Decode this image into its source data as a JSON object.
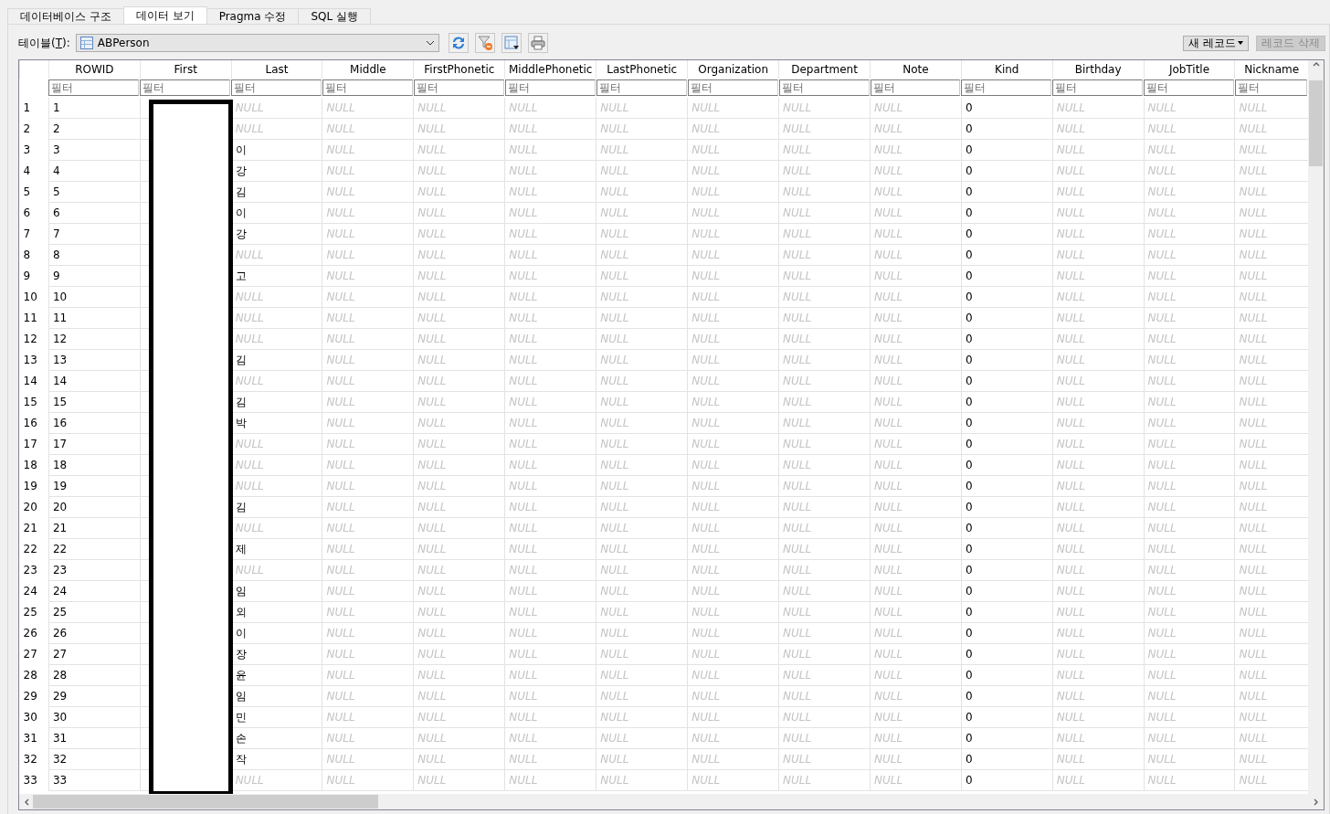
{
  "tabs": [
    {
      "label": "데이터베이스 구조",
      "selected": false
    },
    {
      "label": "데이터 보기",
      "selected": true
    },
    {
      "label": "Pragma 수정",
      "selected": false
    },
    {
      "label": "SQL 실행",
      "selected": false
    }
  ],
  "toolbar": {
    "label_before": "테이블(",
    "accel": "T",
    "label_after": "):",
    "table": "ABPerson",
    "new_record": "새 레코드",
    "delete_record": {
      "label": "레코드 삭제",
      "disabled": true
    }
  },
  "grid": {
    "columns": [
      "ROWID",
      "First",
      "Last",
      "Middle",
      "FirstPhonetic",
      "MiddlePhonetic",
      "LastPhonetic",
      "Organization",
      "Department",
      "Note",
      "Kind",
      "Birthday",
      "JobTitle",
      "Nickname"
    ],
    "filter_placeholders": [
      "필터",
      "필터",
      "필터",
      "필터",
      "필터",
      "필터",
      "필터",
      "필터",
      "필터",
      "필터",
      "필터",
      "필터",
      "필터",
      "필터"
    ],
    "first_column_redacted": true,
    "rows": [
      {
        "num": "1",
        "cells": [
          {
            "t": "1",
            "null": false
          },
          null,
          {
            "t": "NULL",
            "null": true
          },
          {
            "t": "NULL",
            "null": true
          },
          {
            "t": "NULL",
            "null": true
          },
          {
            "t": "NULL",
            "null": true
          },
          {
            "t": "NULL",
            "null": true
          },
          {
            "t": "NULL",
            "null": true
          },
          {
            "t": "NULL",
            "null": true
          },
          {
            "t": "NULL",
            "null": true
          },
          {
            "t": "0",
            "null": false
          },
          {
            "t": "NULL",
            "null": true
          },
          {
            "t": "NULL",
            "null": true
          },
          {
            "t": "NULL",
            "null": true
          }
        ]
      },
      {
        "num": "2",
        "cells": [
          {
            "t": "2",
            "null": false
          },
          null,
          {
            "t": "NULL",
            "null": true
          },
          {
            "t": "NULL",
            "null": true
          },
          {
            "t": "NULL",
            "null": true
          },
          {
            "t": "NULL",
            "null": true
          },
          {
            "t": "NULL",
            "null": true
          },
          {
            "t": "NULL",
            "null": true
          },
          {
            "t": "NULL",
            "null": true
          },
          {
            "t": "NULL",
            "null": true
          },
          {
            "t": "0",
            "null": false
          },
          {
            "t": "NULL",
            "null": true
          },
          {
            "t": "NULL",
            "null": true
          },
          {
            "t": "NULL",
            "null": true
          }
        ]
      },
      {
        "num": "3",
        "cells": [
          {
            "t": "3",
            "null": false
          },
          null,
          {
            "t": "이",
            "null": false
          },
          {
            "t": "NULL",
            "null": true
          },
          {
            "t": "NULL",
            "null": true
          },
          {
            "t": "NULL",
            "null": true
          },
          {
            "t": "NULL",
            "null": true
          },
          {
            "t": "NULL",
            "null": true
          },
          {
            "t": "NULL",
            "null": true
          },
          {
            "t": "NULL",
            "null": true
          },
          {
            "t": "0",
            "null": false
          },
          {
            "t": "NULL",
            "null": true
          },
          {
            "t": "NULL",
            "null": true
          },
          {
            "t": "NULL",
            "null": true
          }
        ]
      },
      {
        "num": "4",
        "cells": [
          {
            "t": "4",
            "null": false
          },
          null,
          {
            "t": "강",
            "null": false
          },
          {
            "t": "NULL",
            "null": true
          },
          {
            "t": "NULL",
            "null": true
          },
          {
            "t": "NULL",
            "null": true
          },
          {
            "t": "NULL",
            "null": true
          },
          {
            "t": "NULL",
            "null": true
          },
          {
            "t": "NULL",
            "null": true
          },
          {
            "t": "NULL",
            "null": true
          },
          {
            "t": "0",
            "null": false
          },
          {
            "t": "NULL",
            "null": true
          },
          {
            "t": "NULL",
            "null": true
          },
          {
            "t": "NULL",
            "null": true
          }
        ]
      },
      {
        "num": "5",
        "cells": [
          {
            "t": "5",
            "null": false
          },
          null,
          {
            "t": "김",
            "null": false
          },
          {
            "t": "NULL",
            "null": true
          },
          {
            "t": "NULL",
            "null": true
          },
          {
            "t": "NULL",
            "null": true
          },
          {
            "t": "NULL",
            "null": true
          },
          {
            "t": "NULL",
            "null": true
          },
          {
            "t": "NULL",
            "null": true
          },
          {
            "t": "NULL",
            "null": true
          },
          {
            "t": "0",
            "null": false
          },
          {
            "t": "NULL",
            "null": true
          },
          {
            "t": "NULL",
            "null": true
          },
          {
            "t": "NULL",
            "null": true
          }
        ]
      },
      {
        "num": "6",
        "cells": [
          {
            "t": "6",
            "null": false
          },
          null,
          {
            "t": "이",
            "null": false
          },
          {
            "t": "NULL",
            "null": true
          },
          {
            "t": "NULL",
            "null": true
          },
          {
            "t": "NULL",
            "null": true
          },
          {
            "t": "NULL",
            "null": true
          },
          {
            "t": "NULL",
            "null": true
          },
          {
            "t": "NULL",
            "null": true
          },
          {
            "t": "NULL",
            "null": true
          },
          {
            "t": "0",
            "null": false
          },
          {
            "t": "NULL",
            "null": true
          },
          {
            "t": "NULL",
            "null": true
          },
          {
            "t": "NULL",
            "null": true
          }
        ]
      },
      {
        "num": "7",
        "cells": [
          {
            "t": "7",
            "null": false
          },
          null,
          {
            "t": "강",
            "null": false
          },
          {
            "t": "NULL",
            "null": true
          },
          {
            "t": "NULL",
            "null": true
          },
          {
            "t": "NULL",
            "null": true
          },
          {
            "t": "NULL",
            "null": true
          },
          {
            "t": "NULL",
            "null": true
          },
          {
            "t": "NULL",
            "null": true
          },
          {
            "t": "NULL",
            "null": true
          },
          {
            "t": "0",
            "null": false
          },
          {
            "t": "NULL",
            "null": true
          },
          {
            "t": "NULL",
            "null": true
          },
          {
            "t": "NULL",
            "null": true
          }
        ]
      },
      {
        "num": "8",
        "cells": [
          {
            "t": "8",
            "null": false
          },
          null,
          {
            "t": "NULL",
            "null": true
          },
          {
            "t": "NULL",
            "null": true
          },
          {
            "t": "NULL",
            "null": true
          },
          {
            "t": "NULL",
            "null": true
          },
          {
            "t": "NULL",
            "null": true
          },
          {
            "t": "NULL",
            "null": true
          },
          {
            "t": "NULL",
            "null": true
          },
          {
            "t": "NULL",
            "null": true
          },
          {
            "t": "0",
            "null": false
          },
          {
            "t": "NULL",
            "null": true
          },
          {
            "t": "NULL",
            "null": true
          },
          {
            "t": "NULL",
            "null": true
          }
        ]
      },
      {
        "num": "9",
        "cells": [
          {
            "t": "9",
            "null": false
          },
          null,
          {
            "t": "고",
            "null": false
          },
          {
            "t": "NULL",
            "null": true
          },
          {
            "t": "NULL",
            "null": true
          },
          {
            "t": "NULL",
            "null": true
          },
          {
            "t": "NULL",
            "null": true
          },
          {
            "t": "NULL",
            "null": true
          },
          {
            "t": "NULL",
            "null": true
          },
          {
            "t": "NULL",
            "null": true
          },
          {
            "t": "0",
            "null": false
          },
          {
            "t": "NULL",
            "null": true
          },
          {
            "t": "NULL",
            "null": true
          },
          {
            "t": "NULL",
            "null": true
          }
        ]
      },
      {
        "num": "10",
        "cells": [
          {
            "t": "10",
            "null": false
          },
          null,
          {
            "t": "NULL",
            "null": true
          },
          {
            "t": "NULL",
            "null": true
          },
          {
            "t": "NULL",
            "null": true
          },
          {
            "t": "NULL",
            "null": true
          },
          {
            "t": "NULL",
            "null": true
          },
          {
            "t": "NULL",
            "null": true
          },
          {
            "t": "NULL",
            "null": true
          },
          {
            "t": "NULL",
            "null": true
          },
          {
            "t": "0",
            "null": false
          },
          {
            "t": "NULL",
            "null": true
          },
          {
            "t": "NULL",
            "null": true
          },
          {
            "t": "NULL",
            "null": true
          }
        ]
      },
      {
        "num": "11",
        "cells": [
          {
            "t": "11",
            "null": false
          },
          null,
          {
            "t": "NULL",
            "null": true
          },
          {
            "t": "NULL",
            "null": true
          },
          {
            "t": "NULL",
            "null": true
          },
          {
            "t": "NULL",
            "null": true
          },
          {
            "t": "NULL",
            "null": true
          },
          {
            "t": "NULL",
            "null": true
          },
          {
            "t": "NULL",
            "null": true
          },
          {
            "t": "NULL",
            "null": true
          },
          {
            "t": "0",
            "null": false
          },
          {
            "t": "NULL",
            "null": true
          },
          {
            "t": "NULL",
            "null": true
          },
          {
            "t": "NULL",
            "null": true
          }
        ]
      },
      {
        "num": "12",
        "cells": [
          {
            "t": "12",
            "null": false
          },
          null,
          {
            "t": "NULL",
            "null": true
          },
          {
            "t": "NULL",
            "null": true
          },
          {
            "t": "NULL",
            "null": true
          },
          {
            "t": "NULL",
            "null": true
          },
          {
            "t": "NULL",
            "null": true
          },
          {
            "t": "NULL",
            "null": true
          },
          {
            "t": "NULL",
            "null": true
          },
          {
            "t": "NULL",
            "null": true
          },
          {
            "t": "0",
            "null": false
          },
          {
            "t": "NULL",
            "null": true
          },
          {
            "t": "NULL",
            "null": true
          },
          {
            "t": "NULL",
            "null": true
          }
        ]
      },
      {
        "num": "13",
        "cells": [
          {
            "t": "13",
            "null": false
          },
          null,
          {
            "t": "김",
            "null": false
          },
          {
            "t": "NULL",
            "null": true
          },
          {
            "t": "NULL",
            "null": true
          },
          {
            "t": "NULL",
            "null": true
          },
          {
            "t": "NULL",
            "null": true
          },
          {
            "t": "NULL",
            "null": true
          },
          {
            "t": "NULL",
            "null": true
          },
          {
            "t": "NULL",
            "null": true
          },
          {
            "t": "0",
            "null": false
          },
          {
            "t": "NULL",
            "null": true
          },
          {
            "t": "NULL",
            "null": true
          },
          {
            "t": "NULL",
            "null": true
          }
        ]
      },
      {
        "num": "14",
        "cells": [
          {
            "t": "14",
            "null": false
          },
          null,
          {
            "t": "NULL",
            "null": true
          },
          {
            "t": "NULL",
            "null": true
          },
          {
            "t": "NULL",
            "null": true
          },
          {
            "t": "NULL",
            "null": true
          },
          {
            "t": "NULL",
            "null": true
          },
          {
            "t": "NULL",
            "null": true
          },
          {
            "t": "NULL",
            "null": true
          },
          {
            "t": "NULL",
            "null": true
          },
          {
            "t": "0",
            "null": false
          },
          {
            "t": "NULL",
            "null": true
          },
          {
            "t": "NULL",
            "null": true
          },
          {
            "t": "NULL",
            "null": true
          }
        ]
      },
      {
        "num": "15",
        "cells": [
          {
            "t": "15",
            "null": false
          },
          null,
          {
            "t": "김",
            "null": false
          },
          {
            "t": "NULL",
            "null": true
          },
          {
            "t": "NULL",
            "null": true
          },
          {
            "t": "NULL",
            "null": true
          },
          {
            "t": "NULL",
            "null": true
          },
          {
            "t": "NULL",
            "null": true
          },
          {
            "t": "NULL",
            "null": true
          },
          {
            "t": "NULL",
            "null": true
          },
          {
            "t": "0",
            "null": false
          },
          {
            "t": "NULL",
            "null": true
          },
          {
            "t": "NULL",
            "null": true
          },
          {
            "t": "NULL",
            "null": true
          }
        ]
      },
      {
        "num": "16",
        "cells": [
          {
            "t": "16",
            "null": false
          },
          null,
          {
            "t": "박",
            "null": false
          },
          {
            "t": "NULL",
            "null": true
          },
          {
            "t": "NULL",
            "null": true
          },
          {
            "t": "NULL",
            "null": true
          },
          {
            "t": "NULL",
            "null": true
          },
          {
            "t": "NULL",
            "null": true
          },
          {
            "t": "NULL",
            "null": true
          },
          {
            "t": "NULL",
            "null": true
          },
          {
            "t": "0",
            "null": false
          },
          {
            "t": "NULL",
            "null": true
          },
          {
            "t": "NULL",
            "null": true
          },
          {
            "t": "NULL",
            "null": true
          }
        ]
      },
      {
        "num": "17",
        "cells": [
          {
            "t": "17",
            "null": false
          },
          null,
          {
            "t": "NULL",
            "null": true
          },
          {
            "t": "NULL",
            "null": true
          },
          {
            "t": "NULL",
            "null": true
          },
          {
            "t": "NULL",
            "null": true
          },
          {
            "t": "NULL",
            "null": true
          },
          {
            "t": "NULL",
            "null": true
          },
          {
            "t": "NULL",
            "null": true
          },
          {
            "t": "NULL",
            "null": true
          },
          {
            "t": "0",
            "null": false
          },
          {
            "t": "NULL",
            "null": true
          },
          {
            "t": "NULL",
            "null": true
          },
          {
            "t": "NULL",
            "null": true
          }
        ]
      },
      {
        "num": "18",
        "cells": [
          {
            "t": "18",
            "null": false
          },
          null,
          {
            "t": "NULL",
            "null": true
          },
          {
            "t": "NULL",
            "null": true
          },
          {
            "t": "NULL",
            "null": true
          },
          {
            "t": "NULL",
            "null": true
          },
          {
            "t": "NULL",
            "null": true
          },
          {
            "t": "NULL",
            "null": true
          },
          {
            "t": "NULL",
            "null": true
          },
          {
            "t": "NULL",
            "null": true
          },
          {
            "t": "0",
            "null": false
          },
          {
            "t": "NULL",
            "null": true
          },
          {
            "t": "NULL",
            "null": true
          },
          {
            "t": "NULL",
            "null": true
          }
        ]
      },
      {
        "num": "19",
        "cells": [
          {
            "t": "19",
            "null": false
          },
          null,
          {
            "t": "NULL",
            "null": true
          },
          {
            "t": "NULL",
            "null": true
          },
          {
            "t": "NULL",
            "null": true
          },
          {
            "t": "NULL",
            "null": true
          },
          {
            "t": "NULL",
            "null": true
          },
          {
            "t": "NULL",
            "null": true
          },
          {
            "t": "NULL",
            "null": true
          },
          {
            "t": "NULL",
            "null": true
          },
          {
            "t": "0",
            "null": false
          },
          {
            "t": "NULL",
            "null": true
          },
          {
            "t": "NULL",
            "null": true
          },
          {
            "t": "NULL",
            "null": true
          }
        ]
      },
      {
        "num": "20",
        "cells": [
          {
            "t": "20",
            "null": false
          },
          null,
          {
            "t": "김",
            "null": false
          },
          {
            "t": "NULL",
            "null": true
          },
          {
            "t": "NULL",
            "null": true
          },
          {
            "t": "NULL",
            "null": true
          },
          {
            "t": "NULL",
            "null": true
          },
          {
            "t": "NULL",
            "null": true
          },
          {
            "t": "NULL",
            "null": true
          },
          {
            "t": "NULL",
            "null": true
          },
          {
            "t": "0",
            "null": false
          },
          {
            "t": "NULL",
            "null": true
          },
          {
            "t": "NULL",
            "null": true
          },
          {
            "t": "NULL",
            "null": true
          }
        ]
      },
      {
        "num": "21",
        "cells": [
          {
            "t": "21",
            "null": false
          },
          null,
          {
            "t": "NULL",
            "null": true
          },
          {
            "t": "NULL",
            "null": true
          },
          {
            "t": "NULL",
            "null": true
          },
          {
            "t": "NULL",
            "null": true
          },
          {
            "t": "NULL",
            "null": true
          },
          {
            "t": "NULL",
            "null": true
          },
          {
            "t": "NULL",
            "null": true
          },
          {
            "t": "NULL",
            "null": true
          },
          {
            "t": "0",
            "null": false
          },
          {
            "t": "NULL",
            "null": true
          },
          {
            "t": "NULL",
            "null": true
          },
          {
            "t": "NULL",
            "null": true
          }
        ]
      },
      {
        "num": "22",
        "cells": [
          {
            "t": "22",
            "null": false
          },
          null,
          {
            "t": "제",
            "null": false
          },
          {
            "t": "NULL",
            "null": true
          },
          {
            "t": "NULL",
            "null": true
          },
          {
            "t": "NULL",
            "null": true
          },
          {
            "t": "NULL",
            "null": true
          },
          {
            "t": "NULL",
            "null": true
          },
          {
            "t": "NULL",
            "null": true
          },
          {
            "t": "NULL",
            "null": true
          },
          {
            "t": "0",
            "null": false
          },
          {
            "t": "NULL",
            "null": true
          },
          {
            "t": "NULL",
            "null": true
          },
          {
            "t": "NULL",
            "null": true
          }
        ]
      },
      {
        "num": "23",
        "cells": [
          {
            "t": "23",
            "null": false
          },
          null,
          {
            "t": "NULL",
            "null": true
          },
          {
            "t": "NULL",
            "null": true
          },
          {
            "t": "NULL",
            "null": true
          },
          {
            "t": "NULL",
            "null": true
          },
          {
            "t": "NULL",
            "null": true
          },
          {
            "t": "NULL",
            "null": true
          },
          {
            "t": "NULL",
            "null": true
          },
          {
            "t": "NULL",
            "null": true
          },
          {
            "t": "0",
            "null": false
          },
          {
            "t": "NULL",
            "null": true
          },
          {
            "t": "NULL",
            "null": true
          },
          {
            "t": "NULL",
            "null": true
          }
        ]
      },
      {
        "num": "24",
        "cells": [
          {
            "t": "24",
            "null": false
          },
          null,
          {
            "t": "임",
            "null": false
          },
          {
            "t": "NULL",
            "null": true
          },
          {
            "t": "NULL",
            "null": true
          },
          {
            "t": "NULL",
            "null": true
          },
          {
            "t": "NULL",
            "null": true
          },
          {
            "t": "NULL",
            "null": true
          },
          {
            "t": "NULL",
            "null": true
          },
          {
            "t": "NULL",
            "null": true
          },
          {
            "t": "0",
            "null": false
          },
          {
            "t": "NULL",
            "null": true
          },
          {
            "t": "NULL",
            "null": true
          },
          {
            "t": "NULL",
            "null": true
          }
        ]
      },
      {
        "num": "25",
        "cells": [
          {
            "t": "25",
            "null": false
          },
          null,
          {
            "t": "외",
            "null": false
          },
          {
            "t": "NULL",
            "null": true
          },
          {
            "t": "NULL",
            "null": true
          },
          {
            "t": "NULL",
            "null": true
          },
          {
            "t": "NULL",
            "null": true
          },
          {
            "t": "NULL",
            "null": true
          },
          {
            "t": "NULL",
            "null": true
          },
          {
            "t": "NULL",
            "null": true
          },
          {
            "t": "0",
            "null": false
          },
          {
            "t": "NULL",
            "null": true
          },
          {
            "t": "NULL",
            "null": true
          },
          {
            "t": "NULL",
            "null": true
          }
        ]
      },
      {
        "num": "26",
        "cells": [
          {
            "t": "26",
            "null": false
          },
          null,
          {
            "t": "이",
            "null": false
          },
          {
            "t": "NULL",
            "null": true
          },
          {
            "t": "NULL",
            "null": true
          },
          {
            "t": "NULL",
            "null": true
          },
          {
            "t": "NULL",
            "null": true
          },
          {
            "t": "NULL",
            "null": true
          },
          {
            "t": "NULL",
            "null": true
          },
          {
            "t": "NULL",
            "null": true
          },
          {
            "t": "0",
            "null": false
          },
          {
            "t": "NULL",
            "null": true
          },
          {
            "t": "NULL",
            "null": true
          },
          {
            "t": "NULL",
            "null": true
          }
        ]
      },
      {
        "num": "27",
        "cells": [
          {
            "t": "27",
            "null": false
          },
          null,
          {
            "t": "장",
            "null": false
          },
          {
            "t": "NULL",
            "null": true
          },
          {
            "t": "NULL",
            "null": true
          },
          {
            "t": "NULL",
            "null": true
          },
          {
            "t": "NULL",
            "null": true
          },
          {
            "t": "NULL",
            "null": true
          },
          {
            "t": "NULL",
            "null": true
          },
          {
            "t": "NULL",
            "null": true
          },
          {
            "t": "0",
            "null": false
          },
          {
            "t": "NULL",
            "null": true
          },
          {
            "t": "NULL",
            "null": true
          },
          {
            "t": "NULL",
            "null": true
          }
        ]
      },
      {
        "num": "28",
        "cells": [
          {
            "t": "28",
            "null": false
          },
          null,
          {
            "t": "윤",
            "null": false
          },
          {
            "t": "NULL",
            "null": true
          },
          {
            "t": "NULL",
            "null": true
          },
          {
            "t": "NULL",
            "null": true
          },
          {
            "t": "NULL",
            "null": true
          },
          {
            "t": "NULL",
            "null": true
          },
          {
            "t": "NULL",
            "null": true
          },
          {
            "t": "NULL",
            "null": true
          },
          {
            "t": "0",
            "null": false
          },
          {
            "t": "NULL",
            "null": true
          },
          {
            "t": "NULL",
            "null": true
          },
          {
            "t": "NULL",
            "null": true
          }
        ]
      },
      {
        "num": "29",
        "cells": [
          {
            "t": "29",
            "null": false
          },
          null,
          {
            "t": "임",
            "null": false
          },
          {
            "t": "NULL",
            "null": true
          },
          {
            "t": "NULL",
            "null": true
          },
          {
            "t": "NULL",
            "null": true
          },
          {
            "t": "NULL",
            "null": true
          },
          {
            "t": "NULL",
            "null": true
          },
          {
            "t": "NULL",
            "null": true
          },
          {
            "t": "NULL",
            "null": true
          },
          {
            "t": "0",
            "null": false
          },
          {
            "t": "NULL",
            "null": true
          },
          {
            "t": "NULL",
            "null": true
          },
          {
            "t": "NULL",
            "null": true
          }
        ]
      },
      {
        "num": "30",
        "cells": [
          {
            "t": "30",
            "null": false
          },
          null,
          {
            "t": "민",
            "null": false
          },
          {
            "t": "NULL",
            "null": true
          },
          {
            "t": "NULL",
            "null": true
          },
          {
            "t": "NULL",
            "null": true
          },
          {
            "t": "NULL",
            "null": true
          },
          {
            "t": "NULL",
            "null": true
          },
          {
            "t": "NULL",
            "null": true
          },
          {
            "t": "NULL",
            "null": true
          },
          {
            "t": "0",
            "null": false
          },
          {
            "t": "NULL",
            "null": true
          },
          {
            "t": "NULL",
            "null": true
          },
          {
            "t": "NULL",
            "null": true
          }
        ]
      },
      {
        "num": "31",
        "cells": [
          {
            "t": "31",
            "null": false
          },
          null,
          {
            "t": "손",
            "null": false
          },
          {
            "t": "NULL",
            "null": true
          },
          {
            "t": "NULL",
            "null": true
          },
          {
            "t": "NULL",
            "null": true
          },
          {
            "t": "NULL",
            "null": true
          },
          {
            "t": "NULL",
            "null": true
          },
          {
            "t": "NULL",
            "null": true
          },
          {
            "t": "NULL",
            "null": true
          },
          {
            "t": "0",
            "null": false
          },
          {
            "t": "NULL",
            "null": true
          },
          {
            "t": "NULL",
            "null": true
          },
          {
            "t": "NULL",
            "null": true
          }
        ]
      },
      {
        "num": "32",
        "cells": [
          {
            "t": "32",
            "null": false
          },
          null,
          {
            "t": "작",
            "null": false
          },
          {
            "t": "NULL",
            "null": true
          },
          {
            "t": "NULL",
            "null": true
          },
          {
            "t": "NULL",
            "null": true
          },
          {
            "t": "NULL",
            "null": true
          },
          {
            "t": "NULL",
            "null": true
          },
          {
            "t": "NULL",
            "null": true
          },
          {
            "t": "NULL",
            "null": true
          },
          {
            "t": "0",
            "null": false
          },
          {
            "t": "NULL",
            "null": true
          },
          {
            "t": "NULL",
            "null": true
          },
          {
            "t": "NULL",
            "null": true
          }
        ]
      },
      {
        "num": "33",
        "cells": [
          {
            "t": "33",
            "null": false
          },
          null,
          {
            "t": "NULL",
            "null": true
          },
          {
            "t": "NULL",
            "null": true
          },
          {
            "t": "NULL",
            "null": true
          },
          {
            "t": "NULL",
            "null": true
          },
          {
            "t": "NULL",
            "null": true
          },
          {
            "t": "NULL",
            "null": true
          },
          {
            "t": "NULL",
            "null": true
          },
          {
            "t": "NULL",
            "null": true
          },
          {
            "t": "0",
            "null": false
          },
          {
            "t": "NULL",
            "null": true
          },
          {
            "t": "NULL",
            "null": true
          },
          {
            "t": "NULL",
            "null": true
          }
        ]
      }
    ]
  }
}
